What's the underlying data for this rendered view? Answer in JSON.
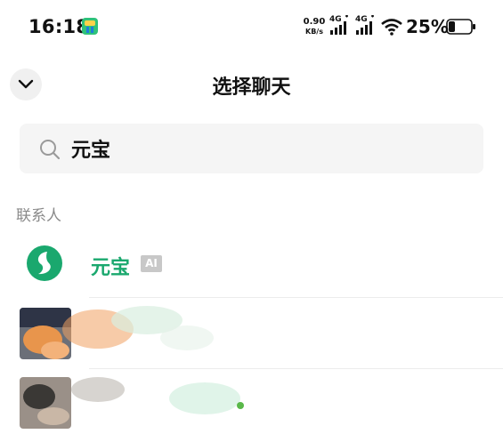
{
  "status_bar": {
    "time": "16:18",
    "net_speed_value": "0.90",
    "net_speed_unit": "KB/s",
    "signal_1": "4G",
    "signal_2": "4G",
    "battery": "25%"
  },
  "header": {
    "title": "选择聊天",
    "collapse_icon": "chevron-down-icon"
  },
  "search": {
    "value": "元宝",
    "icon": "search-icon"
  },
  "contacts": {
    "section_label": "联系人",
    "items": [
      {
        "name": "元宝",
        "badge": "AI",
        "accent": "#1aa86e"
      }
    ]
  },
  "colors": {
    "accent_green": "#1aa86e",
    "search_bg": "#f5f5f5"
  }
}
